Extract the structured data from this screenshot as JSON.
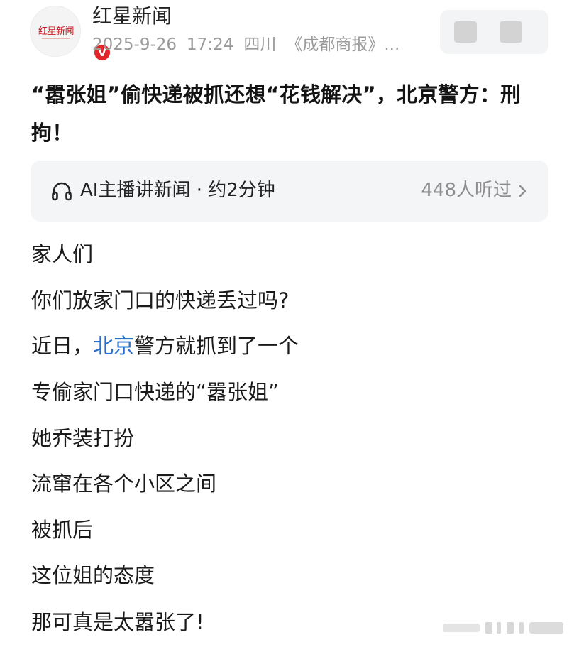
{
  "header": {
    "avatar_logo_text": "红星新闻",
    "verified_badge": "V",
    "source_name": "红星新闻",
    "date": "2025-9-26",
    "time": "17:24",
    "region": "四川",
    "source_ref": "《成都商报》..."
  },
  "article": {
    "title": "“嚣张姐”偷快递被抓还想“花钱解决”，北京警方：刑拘！"
  },
  "audio_card": {
    "label": "AI主播讲新闻 · 约2分钟",
    "listen_count": "448人听过",
    "icon": "headphone-icon",
    "chevron_icon": "chevron-right-icon"
  },
  "body": {
    "line1": "家人们",
    "line2": "你们放家门口的快递丢过吗?",
    "line3_prefix": "近日，",
    "line3_link": "北京",
    "line3_suffix": "警方就抓到了一个",
    "line4": "专偷家门口快递的“嚣张姐”",
    "line5": "她乔装打扮",
    "line6": "流窜在各个小区之间",
    "line7": "被抓后",
    "line8": "这位姐的态度",
    "line9": "那可真是太嚣张了!"
  },
  "colors": {
    "brand_red": "#c8161d",
    "link_blue": "#2a6fc9",
    "meta_gray": "#9a9a9a",
    "card_bg": "#f4f5f7"
  }
}
